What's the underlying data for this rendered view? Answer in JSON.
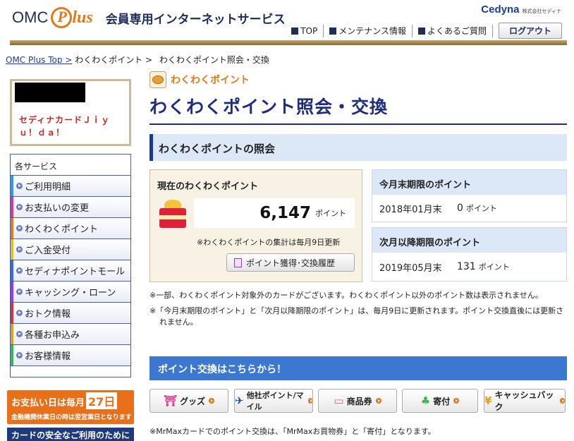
{
  "header": {
    "logo_omc": "OMC",
    "logo_plus": "lus",
    "service_title": "会員専用インターネットサービス",
    "cedyna": "Cedyna",
    "cedyna_sub": "株式会社セディナ",
    "nav": [
      {
        "label": "TOP",
        "icon": "home-icon"
      },
      {
        "label": "メンテナンス情報",
        "icon": "info-icon"
      },
      {
        "label": "よくあるご質問",
        "icon": "question-icon"
      }
    ],
    "logout": "ログアウト"
  },
  "breadcrumb": {
    "home": "OMC Plus Top >",
    "level1": "わくわくポイント >",
    "level2": "わくわくポイント照会・交換"
  },
  "sidebar": {
    "card_name": "セディナカードＪｉｙｕ！ｄａ！",
    "services_title": "各サービス",
    "items": [
      {
        "label": "ご利用明細",
        "color": "#3a9ad8"
      },
      {
        "label": "お支払いの変更",
        "color": "#d83a8a"
      },
      {
        "label": "わくわくポイント",
        "color": "#e07a1c"
      },
      {
        "label": "ご入金受付",
        "color": "#e0c21c"
      },
      {
        "label": "セディナポイントモール",
        "color": "#3a6ad8"
      },
      {
        "label": "キャッシング・ローン",
        "color": "#9a3ad8"
      },
      {
        "label": "おトク情報",
        "color": "#d8323a"
      },
      {
        "label": "各種お申込み",
        "color": "#e0a21c"
      },
      {
        "label": "お客様情報",
        "color": "#3ab84a"
      }
    ],
    "pay_banner_main": "お支払い日は毎月",
    "pay_banner_day": "27日",
    "pay_banner_sub": "金融機関休業日の時は翌営業日となります",
    "safe_banner": "カードの安全なご利用のために"
  },
  "main": {
    "category": "わくわくポイント",
    "title": "わくわくポイント照会・交換",
    "section_title": "わくわくポイントの照会",
    "current": {
      "title": "現在のわくわくポイント",
      "value": "6,147",
      "unit": "ポイント",
      "note": "※わくわくポイントの集計は毎月9日更新",
      "history_button": "ポイント獲得･交換履歴"
    },
    "expiry_this_month": {
      "title": "今月末期限のポイント",
      "date": "2018年01月末",
      "value": "0",
      "unit": "ポイント"
    },
    "expiry_next": {
      "title": "次月以降期限のポイント",
      "date": "2019年05月末",
      "value": "131",
      "unit": "ポイント"
    },
    "notes": [
      "※一部、わくわくポイント対象外のカードがございます。わくわくポイント以外のポイント数は表示されません。",
      "※「今月末期限のポイント」と「次月以降期限のポイント」は、毎月9日に更新されます。ポイント交換直後には更新されません。"
    ],
    "exchange_title": "ポイント交換はこちらから！",
    "exchange_buttons": [
      {
        "label": "グッズ",
        "icon": "gift-icon"
      },
      {
        "label": "他社ポイント/マイル",
        "icon": "plane-icon"
      },
      {
        "label": "商品券",
        "icon": "voucher-icon"
      },
      {
        "label": "寄付",
        "icon": "sprout-icon"
      },
      {
        "label": "キャッシュバック",
        "icon": "yen-icon"
      }
    ],
    "bottom_note": "※MrMaxカードでのポイント交換は、「MrMaxお買物券」と「寄付」となります。"
  }
}
